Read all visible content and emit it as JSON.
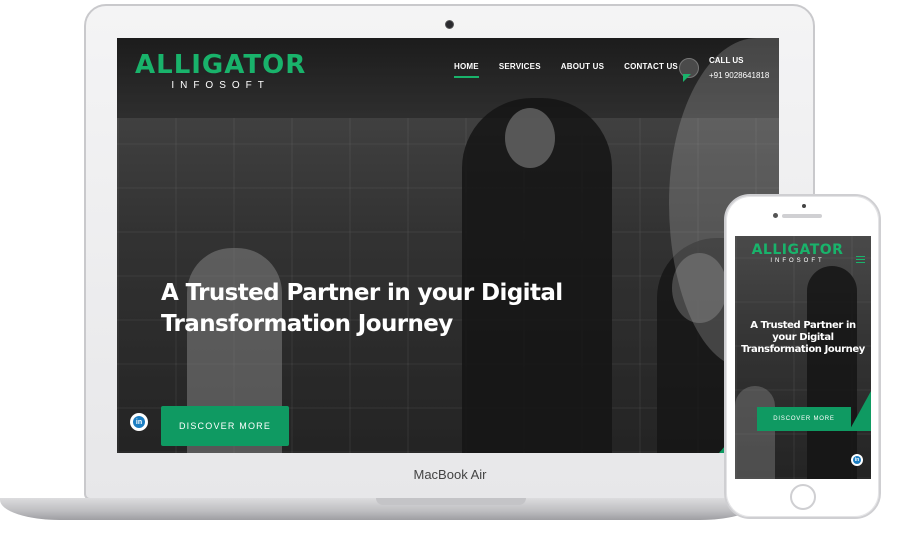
{
  "device_labels": {
    "laptop_brand": "MacBook Air"
  },
  "site": {
    "logo": {
      "name": "ALLIGATOR",
      "tagline": "INFOSOFT"
    },
    "nav": {
      "items": [
        {
          "label": "HOME",
          "active": true
        },
        {
          "label": "SERVICES",
          "active": false
        },
        {
          "label": "ABOUT US",
          "active": false
        },
        {
          "label": "CONTACT US",
          "active": false
        }
      ]
    },
    "contact": {
      "label": "CALL US",
      "phone": "+91 9028641818"
    },
    "hero": {
      "title_line1": "A Trusted Partner in your Digital",
      "title_line2": "Transformation Journey",
      "cta_label": "DISCOVER MORE"
    },
    "social": {
      "linkedin_label": "in"
    }
  },
  "mobile": {
    "hero_title_line1": "A Trusted Partner in",
    "hero_title_line2": "your Digital",
    "hero_title_line3": "Transformation Journey"
  },
  "colors": {
    "brand_green": "#19b36b",
    "button_green": "#0f9a62",
    "linkedin_blue": "#1c7ec2"
  }
}
